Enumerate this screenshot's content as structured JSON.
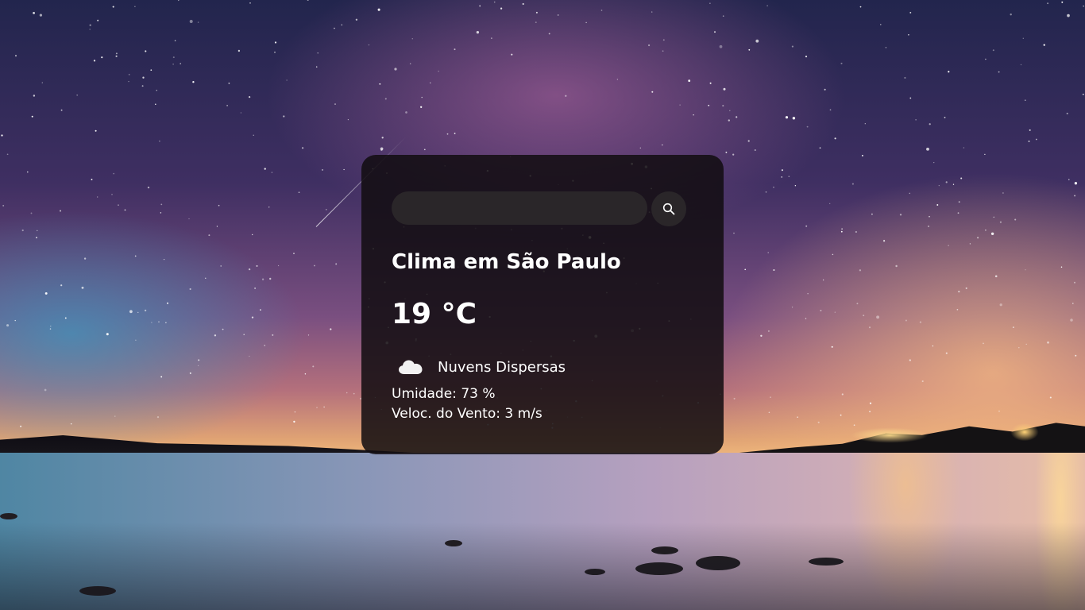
{
  "search": {
    "value": "",
    "placeholder": ""
  },
  "weather": {
    "title": "Clima em São Paulo",
    "temperature": "19 °C",
    "condition_icon": "cloud-icon",
    "condition": "Nuvens Dispersas",
    "humidity_label": "Umidade:",
    "humidity_value": "73 %",
    "wind_label": "Veloc. do Vento:",
    "wind_value": "3 m/s"
  },
  "colors": {
    "card_background": "#110d10",
    "input_background": "#2a2629",
    "text": "#ffffff"
  }
}
